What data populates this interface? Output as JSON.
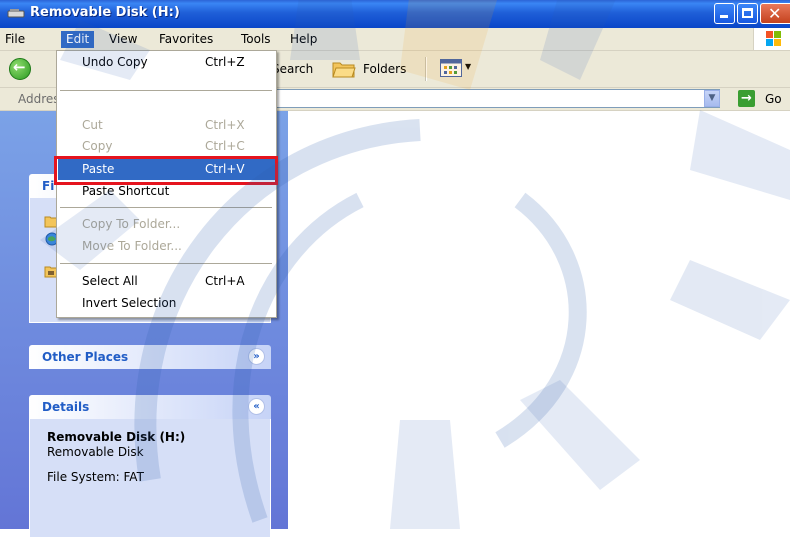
{
  "window": {
    "title": "Removable Disk (H:)"
  },
  "menubar": {
    "items": [
      "File",
      "Edit",
      "View",
      "Favorites",
      "Tools",
      "Help"
    ],
    "active": "Edit"
  },
  "toolbar": {
    "search_label": "Search",
    "folders_label": "Folders"
  },
  "addressbar": {
    "label": "Address",
    "go_label": "Go"
  },
  "edit_menu": {
    "undo": {
      "label": "Undo Copy",
      "shortcut": "Ctrl+Z"
    },
    "cut": {
      "label": "Cut",
      "shortcut": "Ctrl+X"
    },
    "copy": {
      "label": "Copy",
      "shortcut": "Ctrl+C"
    },
    "paste": {
      "label": "Paste",
      "shortcut": "Ctrl+V"
    },
    "paste_shortcut": {
      "label": "Paste Shortcut"
    },
    "copy_to_folder": {
      "label": "Copy To Folder..."
    },
    "move_to_folder": {
      "label": "Move To Folder..."
    },
    "select_all": {
      "label": "Select All",
      "shortcut": "Ctrl+A"
    },
    "invert_selection": {
      "label": "Invert Selection"
    }
  },
  "taskpane": {
    "tasks_title_partial": "Fi",
    "other_places": {
      "title": "Other Places"
    },
    "details": {
      "title": "Details",
      "name": "Removable Disk (H:)",
      "type": "Removable Disk",
      "file_system": "File System: FAT"
    }
  },
  "colors": {
    "titlebar": "#0a46c8",
    "menu_highlight": "#316ac5",
    "annotation": "#e5141e",
    "taskpane": "#6375d6"
  }
}
